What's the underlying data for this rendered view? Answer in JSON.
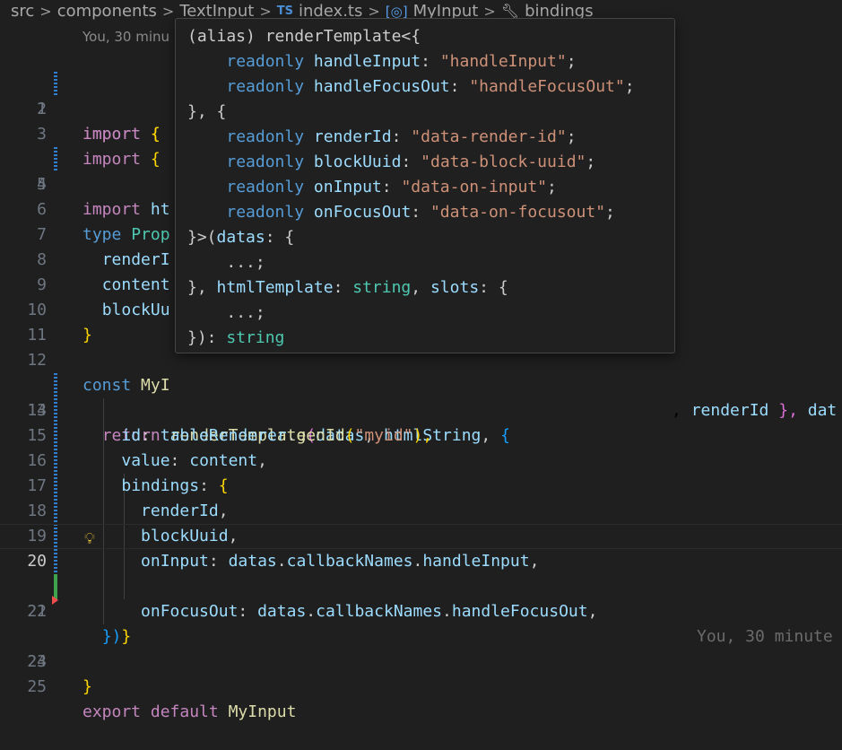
{
  "breadcrumb": {
    "items": [
      "src",
      "components",
      "TextInput",
      "index.ts",
      "MyInput",
      "bindings"
    ],
    "ts_badge": "TS"
  },
  "blame": {
    "top": "You, 30 minu",
    "inline": "You, 30 minute"
  },
  "hover": {
    "h1": "(alias) renderTemplate<{",
    "h2_kw": "readonly",
    "h2_prop": "handleInput",
    "h2_str": "\"handleInput\"",
    "h3_kw": "readonly",
    "h3_prop": "handleFocusOut",
    "h3_str": "\"handleFocusOut\"",
    "h4": "}, {",
    "h5_kw": "readonly",
    "h5_prop": "renderId",
    "h5_str": "\"data-render-id\"",
    "h6_kw": "readonly",
    "h6_prop": "blockUuid",
    "h6_str": "\"data-block-uuid\"",
    "h7_kw": "readonly",
    "h7_prop": "onInput",
    "h7_str": "\"data-on-input\"",
    "h8_kw": "readonly",
    "h8_prop": "onFocusOut",
    "h8_str": "\"data-on-focusout\"",
    "h9a": "}>(",
    "h9b": "datas",
    "h9c": ": {",
    "h10": "...;",
    "h11a": "}, ",
    "h11b": "htmlTemplate",
    "h11c": ": ",
    "h11d": "string",
    "h11e": ", ",
    "h11f": "slots",
    "h11g": ": {",
    "h12": "...;",
    "h13a": "}): ",
    "h13b": "string"
  },
  "code": {
    "l1": "import",
    "l1b": "{",
    "l2": "import",
    "l2b": "{",
    "l3": "import",
    "l3b": "{",
    "l4": "import",
    "l4b": "ht",
    "l6a": "type",
    "l6b": "Prop",
    "l7": "renderI",
    "l8": "content",
    "l9": "blockUu",
    "l10": "}",
    "l12a": "const",
    "l12b": "MyI",
    "l12c": ", ",
    "l12d": "renderId",
    "l12e": " }, ",
    "l12f": "dat",
    "l13a": "return",
    "l13b": "renderTemplate",
    "l13c": "(",
    "l13d": "datas",
    "l13e": ", ",
    "l13f": "htmlString",
    "l13g": ", ",
    "l13h": "{",
    "l14a": "id",
    "l14b": ": ",
    "l14c": "tableRenderer",
    "l14d": ".",
    "l14e": "genId",
    "l14f": "(",
    "l14g": "\"myid\"",
    "l14h": "),",
    "l15a": "value",
    "l15b": ": ",
    "l15c": "content",
    "l15d": ",",
    "l16a": "bindings",
    "l16b": ": ",
    "l16c": "{",
    "l17a": "renderId",
    "l17b": ",",
    "l18a": "blockUuid",
    "l18b": ",",
    "l19a": "onInput",
    "l19b": ": ",
    "l19c": "datas",
    "l19d": ".",
    "l19e": "callbackNames",
    "l19f": ".",
    "l19g": "handleInput",
    "l19h": ",",
    "l20a": "onFocusOut",
    "l20b": ": ",
    "l20c": "datas",
    "l20d": ".",
    "l20e": "callbackNames",
    "l20f": ".",
    "l20g": "handleFocusOut",
    "l20h": ",",
    "l21": "}",
    "l22": "})",
    "l23": "}",
    "l25a": "export",
    "l25b": "default",
    "l25c": "MyInput"
  },
  "line_numbers": [
    "1",
    "2",
    "3",
    "4",
    "5",
    "6",
    "7",
    "8",
    "9",
    "10",
    "11",
    "12",
    "13",
    "14",
    "15",
    "16",
    "17",
    "18",
    "19",
    "20",
    "21",
    "22",
    "23",
    "24",
    "25"
  ],
  "colors": {
    "background": "#1f1f1f",
    "keyword": "#c586c0",
    "storage": "#569cd6",
    "type": "#4ec9b0",
    "function": "#dcdcaa",
    "property": "#9cdcfe",
    "string": "#ce9178"
  }
}
